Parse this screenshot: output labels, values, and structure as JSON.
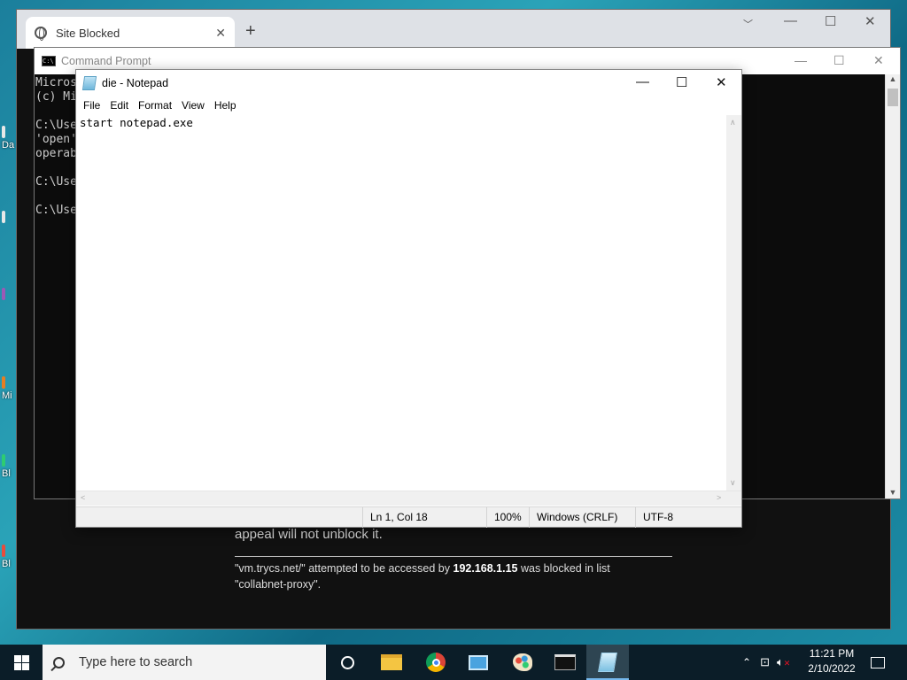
{
  "colors": {
    "desktop": "#1b7f9c",
    "taskbar": "#0b1d28",
    "console_text": "#cccccc",
    "active_task": "#76b9ed"
  },
  "desktop": {
    "icon_labels": [
      "Da",
      "Mi",
      "Bl",
      "Bl"
    ]
  },
  "chrome": {
    "tab_title": "Site Blocked",
    "tab_close": "✕",
    "new_tab": "+",
    "controls": {
      "minimize": "﹀",
      "min": "—",
      "max": "☐",
      "close": "✕"
    },
    "page": {
      "appeal_text": "appeal will not unblock it.",
      "url": "\"vm.trycs.net/\"",
      "mid1": " attempted to be accessed by ",
      "ip": "192.168.1.15",
      "mid2": " was blocked in list",
      "list": "\"collabnet-proxy\"."
    }
  },
  "cmd": {
    "title": "Command Prompt",
    "icon_text": "C:\\",
    "controls": {
      "min": "—",
      "max": "☐",
      "close": "✕"
    },
    "lines": [
      "Micros",
      "(c) Mi",
      "",
      "C:\\Use",
      "'open'",
      "operab",
      "",
      "C:\\Use",
      "",
      "C:\\Use"
    ]
  },
  "notepad": {
    "title": "die - Notepad",
    "controls": {
      "min": "—",
      "max": "☐",
      "close": "✕"
    },
    "menu": [
      "File",
      "Edit",
      "Format",
      "View",
      "Help"
    ],
    "content": "start notepad.exe",
    "status": {
      "position": "Ln 1, Col 18",
      "zoom": "100%",
      "line_ending": "Windows (CRLF)",
      "encoding": "UTF-8"
    }
  },
  "taskbar": {
    "search_placeholder": "Type here to search",
    "apps": [
      "task-view-icon",
      "file-explorer-icon",
      "chrome-icon",
      "control-panel-icon",
      "paint-icon",
      "command-prompt-icon",
      "notepad-icon"
    ],
    "time": "11:21 PM",
    "date": "2/10/2022"
  }
}
